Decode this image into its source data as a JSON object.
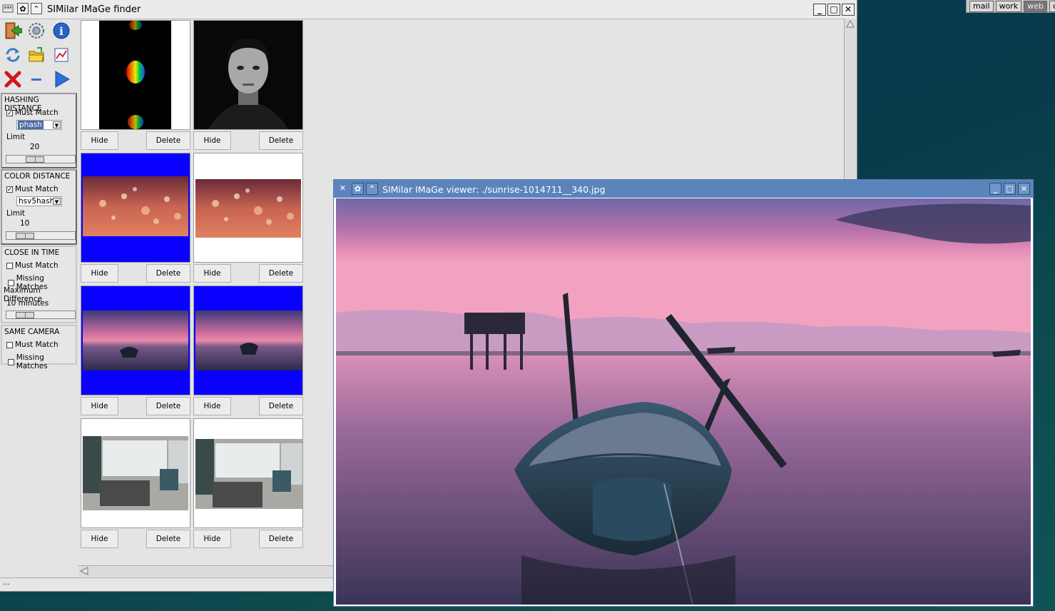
{
  "desktop": {
    "tags": [
      {
        "label": "mail",
        "active": false
      },
      {
        "label": "work",
        "active": false
      },
      {
        "label": "web",
        "active": true
      },
      {
        "label": "c",
        "active": false
      }
    ]
  },
  "main_window": {
    "title": "SIMilar IMaGe finder",
    "hashing": {
      "title": "HASHING DISTANCE",
      "must_match": "Must Match",
      "algorithm": "phash",
      "limit_label": "Limit",
      "limit_value": "20"
    },
    "color": {
      "title": "COLOR DISTANCE",
      "must_match": "Must Match",
      "algorithm": "hsv5hash",
      "limit_label": "Limit",
      "limit_value": "10"
    },
    "time": {
      "title": "CLOSE IN TIME",
      "must_match": "Must Match",
      "missing": "Missing Matches",
      "max_diff_label": "Maximum Difference",
      "max_diff_value": "10 minutes"
    },
    "camera": {
      "title": "SAME CAMERA",
      "must_match": "Must Match",
      "missing": "Missing Matches"
    },
    "buttons": {
      "hide": "Hide",
      "delete": "Delete"
    },
    "status": "..."
  },
  "viewer": {
    "title": "SIMilar IMaGe viewer: ./sunrise-1014711__340.jpg"
  },
  "colors": {
    "selected": "#0a00ff",
    "viewer_title": "#5b84bd"
  }
}
